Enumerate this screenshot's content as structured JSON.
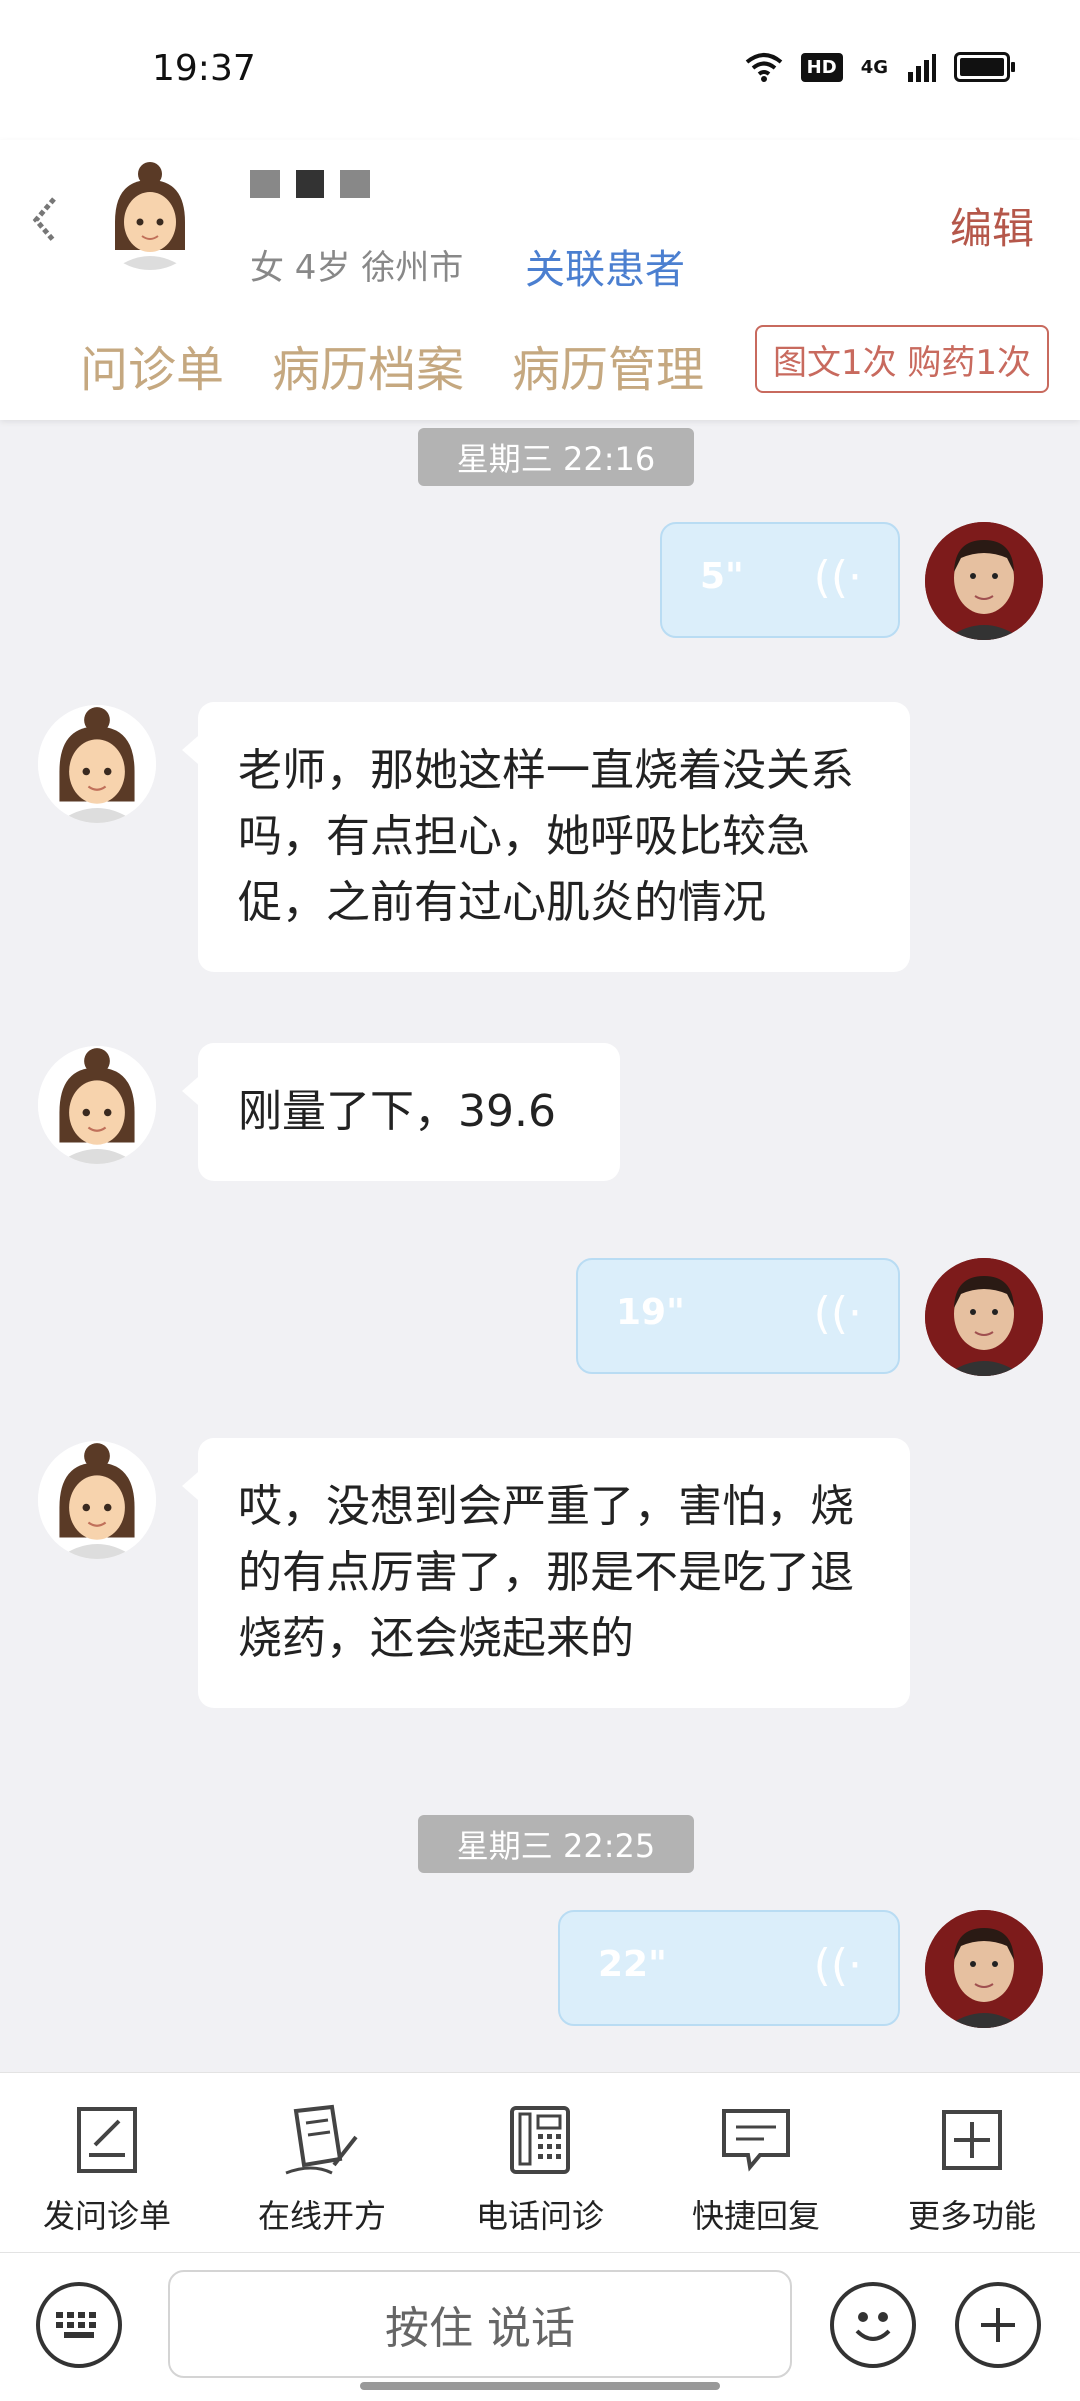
{
  "status_bar": {
    "time": "19:37",
    "hd": "HD",
    "network": "4G"
  },
  "header": {
    "patient_info": "女 4岁  徐州市",
    "related_link": "关联患者",
    "edit_label": "编辑",
    "tabs": [
      "问诊单",
      "病历档案",
      "病历管理"
    ],
    "count_badge": "图文1次 购药1次"
  },
  "messages": [
    {
      "kind": "timestamp",
      "text": "星期三 22:16"
    },
    {
      "kind": "voice",
      "side": "right",
      "duration": "5\""
    },
    {
      "kind": "text",
      "side": "left",
      "text": "老师，那她这样一直烧着没关系吗，有点担心，她呼吸比较急促，之前有过心肌炎的情况"
    },
    {
      "kind": "text",
      "side": "left",
      "text": "刚量了下，39.6"
    },
    {
      "kind": "voice",
      "side": "right",
      "duration": "19\""
    },
    {
      "kind": "text",
      "side": "left",
      "text": "哎，没想到会严重了，害怕，烧的有点厉害了，那是不是吃了退烧药，还会烧起来的"
    },
    {
      "kind": "timestamp",
      "text": "星期三 22:25"
    },
    {
      "kind": "voice",
      "side": "right",
      "duration": "22\""
    }
  ],
  "toolbar": [
    {
      "label": "发问诊单",
      "icon": "document-edit-icon"
    },
    {
      "label": "在线开方",
      "icon": "prescription-icon"
    },
    {
      "label": "电话问诊",
      "icon": "phone-icon"
    },
    {
      "label": "快捷回复",
      "icon": "message-icon"
    },
    {
      "label": "更多功能",
      "icon": "plus-square-icon"
    }
  ],
  "input": {
    "hold_to_talk": "按住 说话"
  },
  "colors": {
    "accent_blue": "#4b7fd0",
    "edit_red": "#b5574a",
    "tab_gold": "#c5a880",
    "voice_bubble": "#dbeefa"
  }
}
